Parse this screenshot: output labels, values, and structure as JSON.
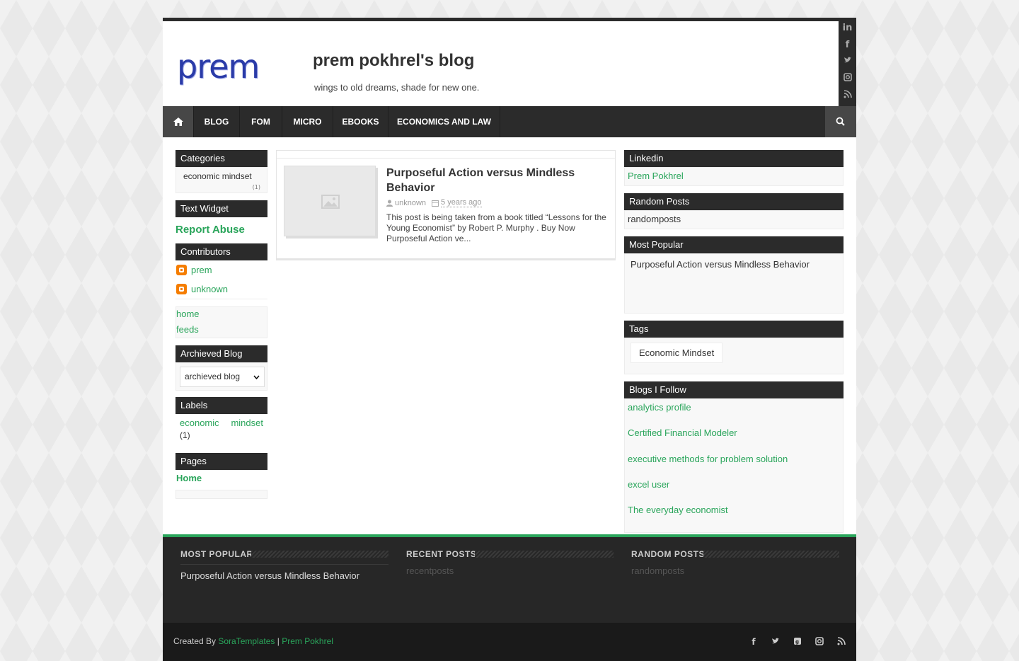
{
  "header": {
    "logo_text": "prem",
    "title": "prem pokhrel's blog",
    "description": "wings to old dreams, shade for new one."
  },
  "nav": {
    "items": [
      "BLOG",
      "FOM",
      "MICRO",
      "EBOOKS",
      "ECONOMICS AND LAW"
    ]
  },
  "left": {
    "categories_title": "Categories",
    "category_item": "economic mindset",
    "category_count": "(1)",
    "text_widget_title": "Text Widget",
    "report_abuse": "Report Abuse",
    "contributors_title": "Contributors",
    "contributors": [
      "prem",
      "unknown"
    ],
    "links": [
      "home",
      "feeds"
    ],
    "archive_title": "Archieved Blog",
    "archive_select": "archieved blog",
    "labels_title": "Labels",
    "label_a": "economic",
    "label_b": "mindset",
    "label_count": "(1)",
    "pages_title": "Pages",
    "pages_home": "Home"
  },
  "post": {
    "title": "Purposeful Action versus Mindless Behavior",
    "author": "unknown",
    "date": "5 years ago",
    "excerpt": "This post is being taken from a book titled “Lessons for the Young Economist” by Robert P. Murphy . Buy Now Purposeful Action ve..."
  },
  "right": {
    "linkedin_title": "Linkedin",
    "linkedin_link": "Prem Pokhrel",
    "random_title": "Random Posts",
    "random_text": "randomposts",
    "popular_title": "Most Popular",
    "popular_item": "Purposeful Action versus Mindless Behavior",
    "tags_title": "Tags",
    "tag": "Economic Mindset",
    "blogs_title": "Blogs I Follow",
    "blogs": [
      "analytics profile",
      "Certified Financial Modeler",
      "executive methods for problem solution",
      "excel user",
      "The everyday economist"
    ]
  },
  "footer": {
    "popular_title": "MOST POPULAR",
    "popular_item": "Purposeful Action versus Mindless Behavior",
    "recent_title": "RECENT POSTS",
    "recent_text": "recentposts",
    "random_title": "RANDOM POSTS",
    "random_text": "randomposts",
    "created_by": "Created By",
    "sora": "SoraTemplates",
    "sep": "|",
    "author_link": "Prem Pokhrel"
  },
  "icons": {
    "home": "home-icon",
    "search": "search-icon",
    "social": [
      "linkedin-icon",
      "facebook-icon",
      "twitter-icon",
      "instagram-icon",
      "rss-icon"
    ],
    "footer_social": [
      "facebook-icon",
      "twitter-icon",
      "google-plus-icon",
      "instagram-icon",
      "rss-icon"
    ]
  },
  "colors": {
    "accent": "#2aa55b",
    "dark": "#2b2b2b"
  }
}
